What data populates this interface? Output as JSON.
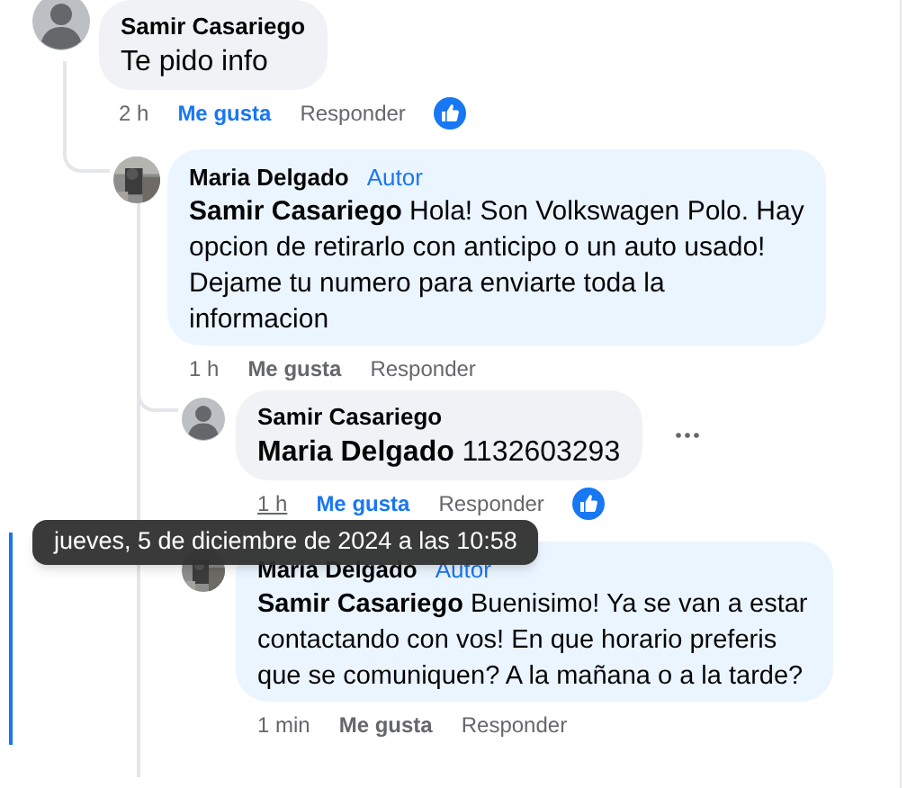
{
  "comments": [
    {
      "author": "Samir Casariego",
      "has_photo": false,
      "text": "Te pido info",
      "time": "2 h",
      "like_label": "Me gusta",
      "reply_label": "Responder",
      "liked": true,
      "children": [
        {
          "author": "Maria Delgado",
          "badge": "Autor",
          "has_photo": true,
          "text": "**Samir Casariego** Hola! Son Volkswagen Polo. Hay opcion de retirarlo con anticipo o un auto usado! Dejame tu numero para enviarte toda la informacion",
          "time": "1 h",
          "like_label": "Me gusta",
          "reply_label": "Responder",
          "liked": false,
          "children": [
            {
              "author": "Samir Casariego",
              "has_photo": false,
              "text": "**Maria Delgado** 1132603293",
              "time": "1 h",
              "time_hovered": true,
              "like_label": "Me gusta",
              "reply_label": "Responder",
              "liked": true,
              "menu_shown": true
            },
            {
              "author": "Maria Delgado",
              "badge": "Autor",
              "has_photo": true,
              "text": "**Samir Casariego** Buenisimo! Ya se van a estar contactando con vos! En que horario preferis que se comuniquen? A la mañana o a la tarde?",
              "time": "1 min",
              "like_label": "Me gusta",
              "reply_label": "Responder",
              "liked": false,
              "highlighted": true
            }
          ]
        }
      ]
    }
  ],
  "tooltip": {
    "text": "jueves, 5 de diciembre de 2024 a las 10:58"
  }
}
